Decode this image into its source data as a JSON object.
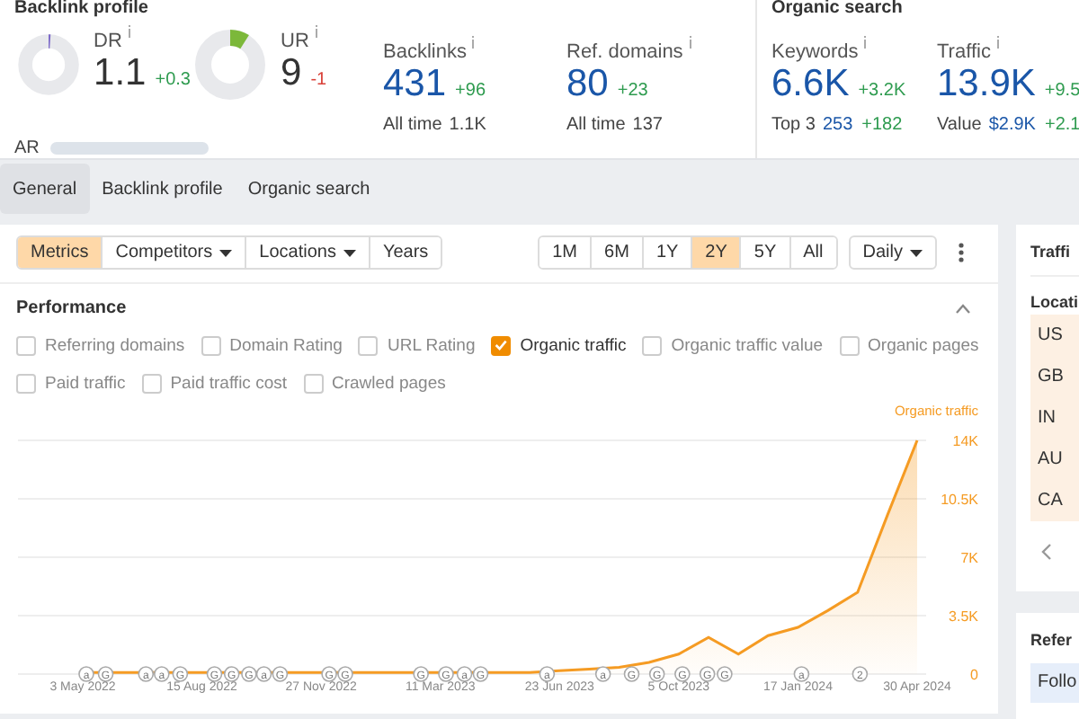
{
  "overview": {
    "sections": [
      {
        "title": "Backlink profile",
        "metrics": [
          {
            "kind": "donut",
            "label": "DR",
            "value": "1.1",
            "delta": "+0.3",
            "positive": true,
            "level": 0.011,
            "color": "#7b68c8"
          },
          {
            "kind": "donut",
            "label": "UR",
            "value": "9",
            "delta": "-1",
            "positive": false,
            "level": 0.09,
            "color": "#7cb83a"
          },
          {
            "kind": "number",
            "label": "Backlinks",
            "value": "431",
            "delta": "+96",
            "positive": true,
            "sub_label": "All time",
            "sub_value": "1.1K"
          },
          {
            "kind": "number",
            "label": "Ref. domains",
            "value": "80",
            "delta": "+23",
            "positive": true,
            "sub_label": "All time",
            "sub_value": "137"
          }
        ],
        "footnote": "AR"
      },
      {
        "title": "Organic search",
        "metrics": [
          {
            "kind": "number",
            "label": "Keywords",
            "value": "6.6K",
            "delta": "+3.2K",
            "positive": true,
            "sub_label": "Top 3",
            "sub_value": "253",
            "sub_delta": "+182"
          },
          {
            "kind": "number",
            "label": "Traffic",
            "value": "13.9K",
            "delta": "+9.5",
            "positive": true,
            "sub_label": "Value",
            "sub_value": "$2.9K",
            "sub_delta": "+2.1"
          }
        ]
      }
    ]
  },
  "tabs": [
    {
      "label": "General",
      "selected": true
    },
    {
      "label": "Backlink profile",
      "selected": false
    },
    {
      "label": "Organic search",
      "selected": false
    }
  ],
  "toolbar": {
    "views": [
      {
        "label": "Metrics",
        "selected": true,
        "dropdown": false
      },
      {
        "label": "Competitors",
        "selected": false,
        "dropdown": true
      },
      {
        "label": "Locations",
        "selected": false,
        "dropdown": true
      },
      {
        "label": "Years",
        "selected": false,
        "dropdown": false
      }
    ],
    "ranges": [
      {
        "label": "1M",
        "selected": false
      },
      {
        "label": "6M",
        "selected": false
      },
      {
        "label": "1Y",
        "selected": false
      },
      {
        "label": "2Y",
        "selected": true
      },
      {
        "label": "5Y",
        "selected": false
      },
      {
        "label": "All",
        "selected": false
      }
    ],
    "interval": "Daily"
  },
  "performance": {
    "title": "Performance",
    "expanded": true,
    "series_toggles": [
      [
        {
          "label": "Referring domains",
          "checked": false
        },
        {
          "label": "Domain Rating",
          "checked": false
        },
        {
          "label": "URL Rating",
          "checked": false
        },
        {
          "label": "Organic traffic",
          "checked": true
        },
        {
          "label": "Organic traffic value",
          "checked": false
        },
        {
          "label": "Organic pages",
          "checked": false
        }
      ],
      [
        {
          "label": "Paid traffic",
          "checked": false
        },
        {
          "label": "Paid traffic cost",
          "checked": false
        },
        {
          "label": "Crawled pages",
          "checked": false
        }
      ]
    ],
    "chart_data": {
      "type": "area",
      "series": [
        {
          "name": "Organic traffic",
          "color": "#f59b23",
          "values": [
            100,
            100,
            100,
            100,
            100,
            100,
            100,
            100,
            100,
            100,
            100,
            100,
            100,
            100,
            100,
            100,
            200,
            300,
            400,
            700,
            1200,
            2200,
            1200,
            2300,
            2800,
            3800,
            4900,
            9500,
            14000
          ]
        }
      ],
      "categories": [
        "3 May 2022",
        null,
        null,
        null,
        "15 Aug 2022",
        null,
        null,
        null,
        "27 Nov 2022",
        null,
        null,
        null,
        "11 Mar 2023",
        null,
        null,
        null,
        "23 Jun 2023",
        null,
        null,
        null,
        "5 Oct 2023",
        null,
        null,
        null,
        "17 Jan 2024",
        null,
        null,
        null,
        "30 Apr 2024"
      ],
      "grid": true,
      "ylim": [
        0,
        14000
      ],
      "yticks": [
        {
          "value": 0,
          "label": "0"
        },
        {
          "value": 3500,
          "label": "3.5K"
        },
        {
          "value": 7000,
          "label": "7K"
        },
        {
          "value": 10500,
          "label": "10.5K"
        },
        {
          "value": 14000,
          "label": "14K"
        }
      ],
      "annotations": [
        {
          "text": "a"
        },
        {
          "text": "G"
        },
        {
          "text": "a"
        },
        {
          "text": "a"
        },
        {
          "text": "G"
        },
        {
          "text": "G"
        },
        {
          "text": "G"
        },
        {
          "text": "G"
        },
        {
          "text": "a"
        },
        {
          "text": "G"
        },
        {
          "text": "G"
        },
        {
          "text": "G"
        },
        {
          "text": "G"
        },
        {
          "text": "G"
        },
        {
          "text": "a"
        },
        {
          "text": "G"
        },
        {
          "text": "a"
        },
        {
          "text": "a"
        },
        {
          "text": "G"
        },
        {
          "text": "G"
        },
        {
          "text": "G"
        },
        {
          "text": "G"
        },
        {
          "text": "G"
        },
        {
          "text": "a"
        },
        {
          "text": "2"
        }
      ]
    }
  },
  "side": {
    "title": "Traffi",
    "locations_title": "Locati",
    "locations": [
      "US",
      "GB",
      "IN",
      "AU",
      "CA"
    ],
    "second_title": "Refer",
    "second_row": "Follo"
  }
}
